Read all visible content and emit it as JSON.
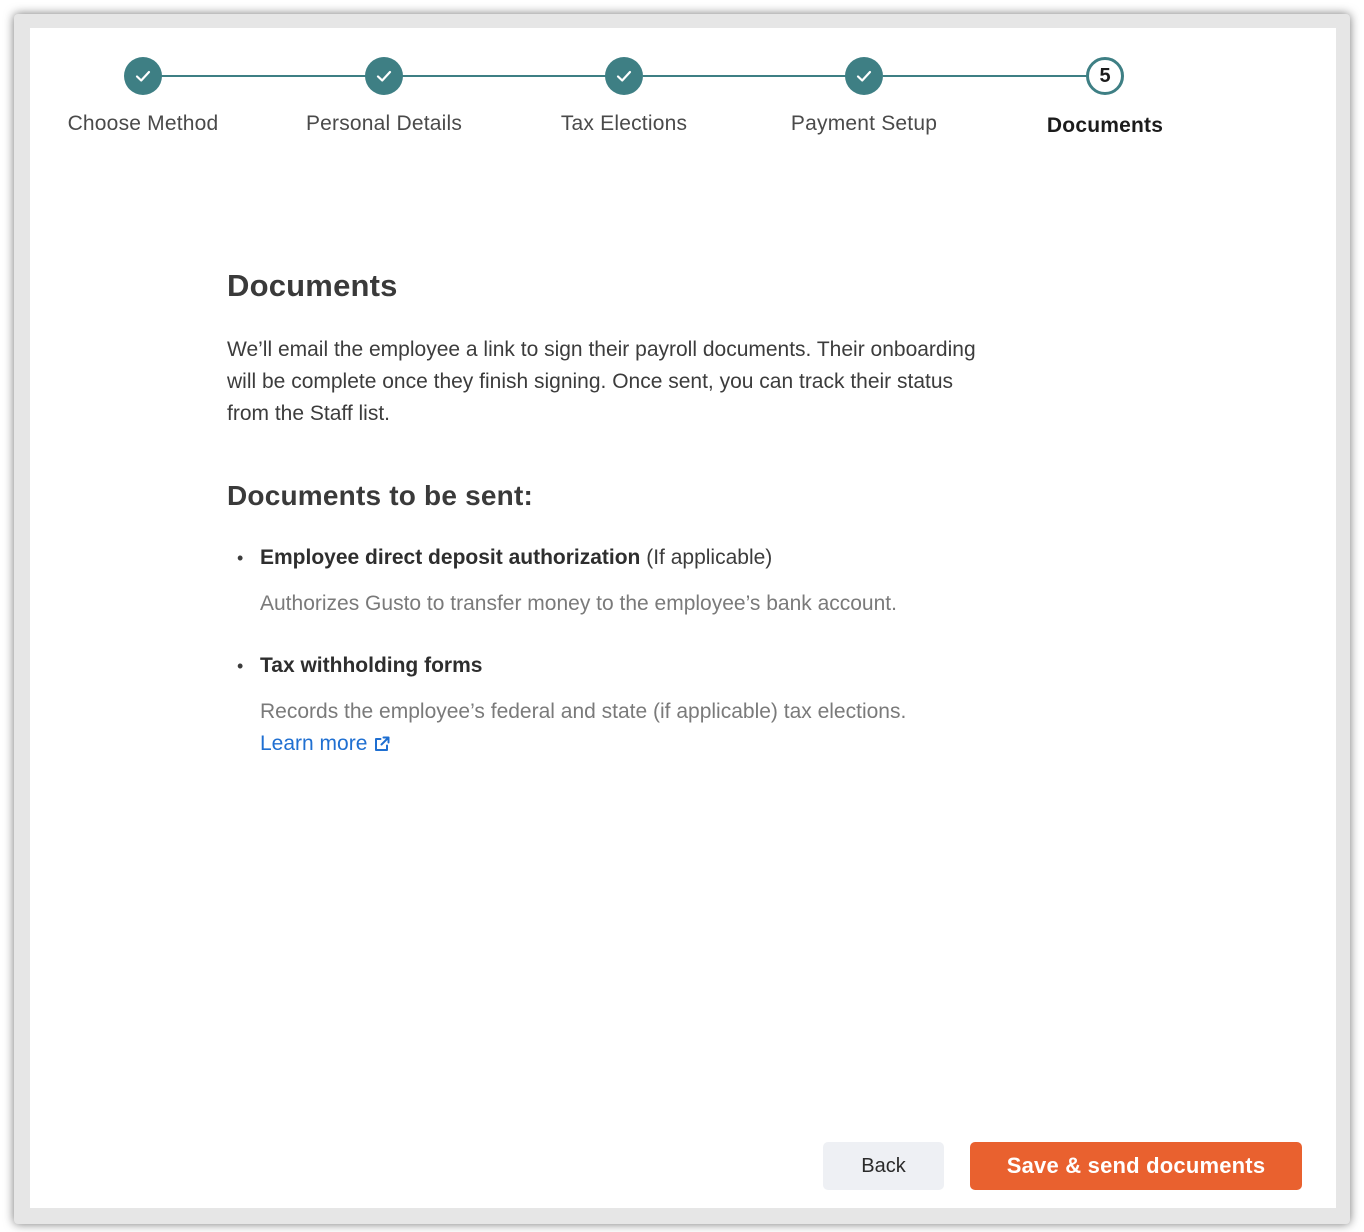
{
  "stepper": {
    "steps": [
      {
        "label": "Choose Method",
        "status": "done"
      },
      {
        "label": "Personal Details",
        "status": "done"
      },
      {
        "label": "Tax Elections",
        "status": "done"
      },
      {
        "label": "Payment Setup",
        "status": "done"
      },
      {
        "label": "Documents",
        "status": "current",
        "number": "5"
      }
    ]
  },
  "main": {
    "title": "Documents",
    "intro": "We’ll email the employee a link to sign their payroll documents. Their onboarding will be complete once they finish signing. Once sent, you can track their status from the Staff list.",
    "subtitle": "Documents to be sent:",
    "documents": [
      {
        "title": "Employee direct deposit authorization",
        "qualifier": "(If applicable)",
        "description": "Authorizes Gusto to transfer money to the employee’s bank account."
      },
      {
        "title": "Tax withholding forms",
        "description": "Records the employee’s federal and state (if applicable) tax elections.",
        "link_label": "Learn more"
      }
    ]
  },
  "footer": {
    "back_label": "Back",
    "save_label": "Save & send documents"
  },
  "colors": {
    "accent": "#3e7f84",
    "primary_button": "#e9612f",
    "link": "#1f6fd1"
  }
}
